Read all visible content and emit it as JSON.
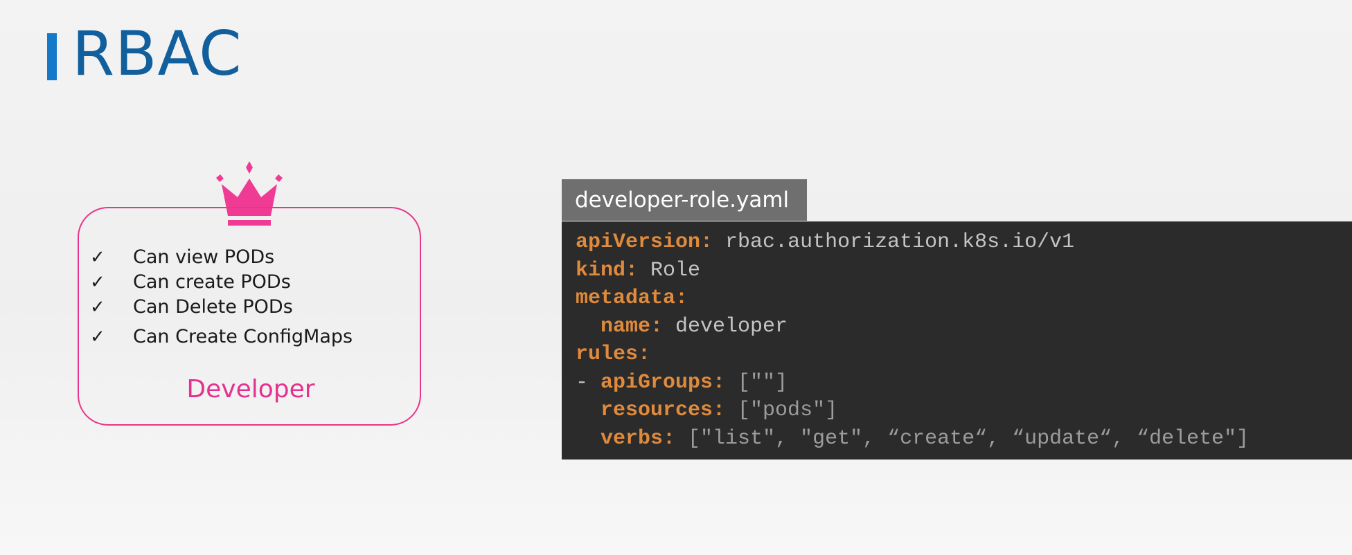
{
  "slide": {
    "title": "RBAC",
    "accent_color": "#1479c8",
    "title_color": "#115f9c"
  },
  "role_card": {
    "icon": "crown-icon",
    "border_color": "#e8348a",
    "check_glyph": "✓",
    "permissions": [
      "Can view PODs",
      "Can create PODs",
      "Can Delete PODs",
      "Can Create ConfigMaps"
    ],
    "role_name": "Developer"
  },
  "yaml_file": {
    "filename": "developer-role.yaml",
    "lines": {
      "api_version": {
        "key": "apiVersion:",
        "value": " rbac.authorization.k8s.io/v1"
      },
      "kind": {
        "key": "kind:",
        "value": " Role"
      },
      "metadata": {
        "key": "metadata:"
      },
      "name": {
        "indent": "  ",
        "key": "name:",
        "value": " developer"
      },
      "rules": {
        "key": "rules:"
      },
      "api_groups": {
        "prefix": "- ",
        "key": "apiGroups:",
        "value": " [\"\"]"
      },
      "resources": {
        "indent": "  ",
        "key": "resources:",
        "value": " [\"pods\"]"
      },
      "verbs": {
        "indent": "  ",
        "key": "verbs:",
        "value": " [\"list\", \"get\", “create“, “update“, “delete\"]"
      }
    },
    "colors": {
      "key": "#e08a3c",
      "background": "#2b2b2b",
      "tab_background": "#6f6f6f"
    }
  }
}
